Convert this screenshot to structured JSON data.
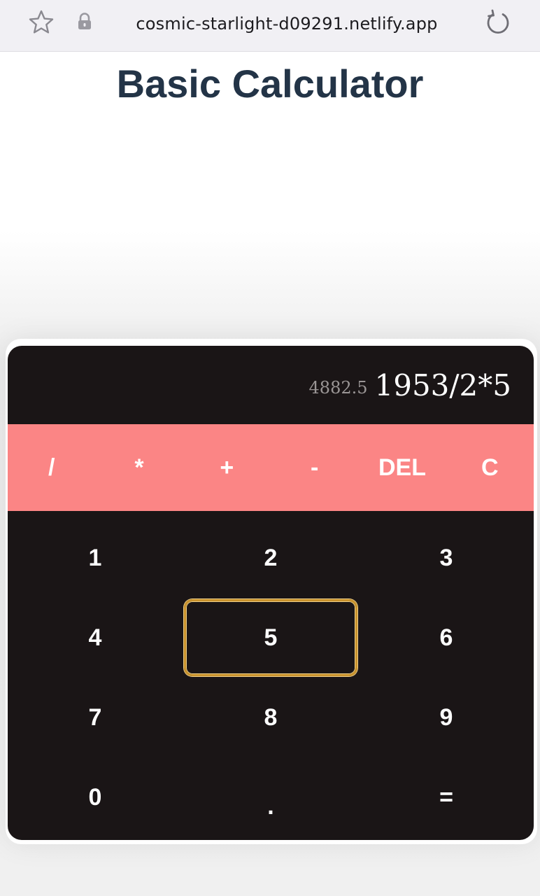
{
  "browser": {
    "url": "cosmic-starlight-d09291.netlify.app",
    "icons": [
      "star-icon",
      "lock-icon",
      "reload-icon"
    ]
  },
  "page": {
    "title": "Basic Calculator"
  },
  "calculator": {
    "display": {
      "result": "4882.5",
      "expression": "1953/2*5"
    },
    "operators": [
      "/",
      "*",
      "+",
      "-",
      "DEL",
      "C"
    ],
    "keys": [
      "1",
      "2",
      "3",
      "4",
      "5",
      "6",
      "7",
      "8",
      "9",
      "0",
      ".",
      "="
    ],
    "focused_key": "5",
    "colors": {
      "body": "#1a1516",
      "operator_bar": "#fb8585",
      "title": "#233447",
      "focus_ring": "#c9922c"
    }
  }
}
